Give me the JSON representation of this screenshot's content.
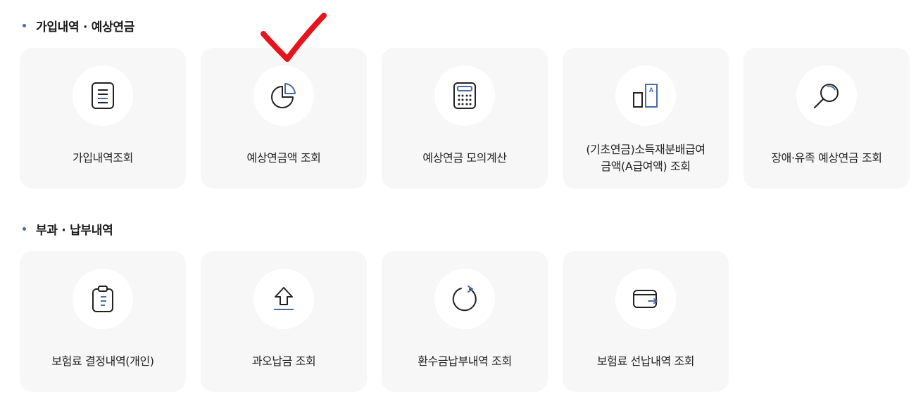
{
  "sections": [
    {
      "title": "가입내역 · 예상연금",
      "cards": [
        {
          "label": "가입내역조회",
          "icon": "document-icon"
        },
        {
          "label": "예상연금액 조회",
          "icon": "pie-chart-icon"
        },
        {
          "label": "예상연금 모의계산",
          "icon": "calculator-icon"
        },
        {
          "label_line1": "(기초연금)소득재분배급여",
          "label_line2": "금액(A급여액) 조회",
          "icon": "a-value-chart-icon"
        },
        {
          "label": "장애·유족 예상연금 조회",
          "icon": "magnifier-icon"
        }
      ]
    },
    {
      "title": "부과 · 납부내역",
      "cards": [
        {
          "label": "보험료 결정내역(개인)",
          "icon": "clipboard-icon"
        },
        {
          "label": "과오납금 조회",
          "icon": "upload-arrow-icon"
        },
        {
          "label": "환수금납부내역 조회",
          "icon": "refresh-icon"
        },
        {
          "label": "보험료 선납내역 조회",
          "icon": "wallet-icon"
        }
      ]
    }
  ],
  "colors": {
    "accent": "#4a6aa8",
    "card_bg": "#f7f7f7",
    "annotation": "#e8141c"
  }
}
